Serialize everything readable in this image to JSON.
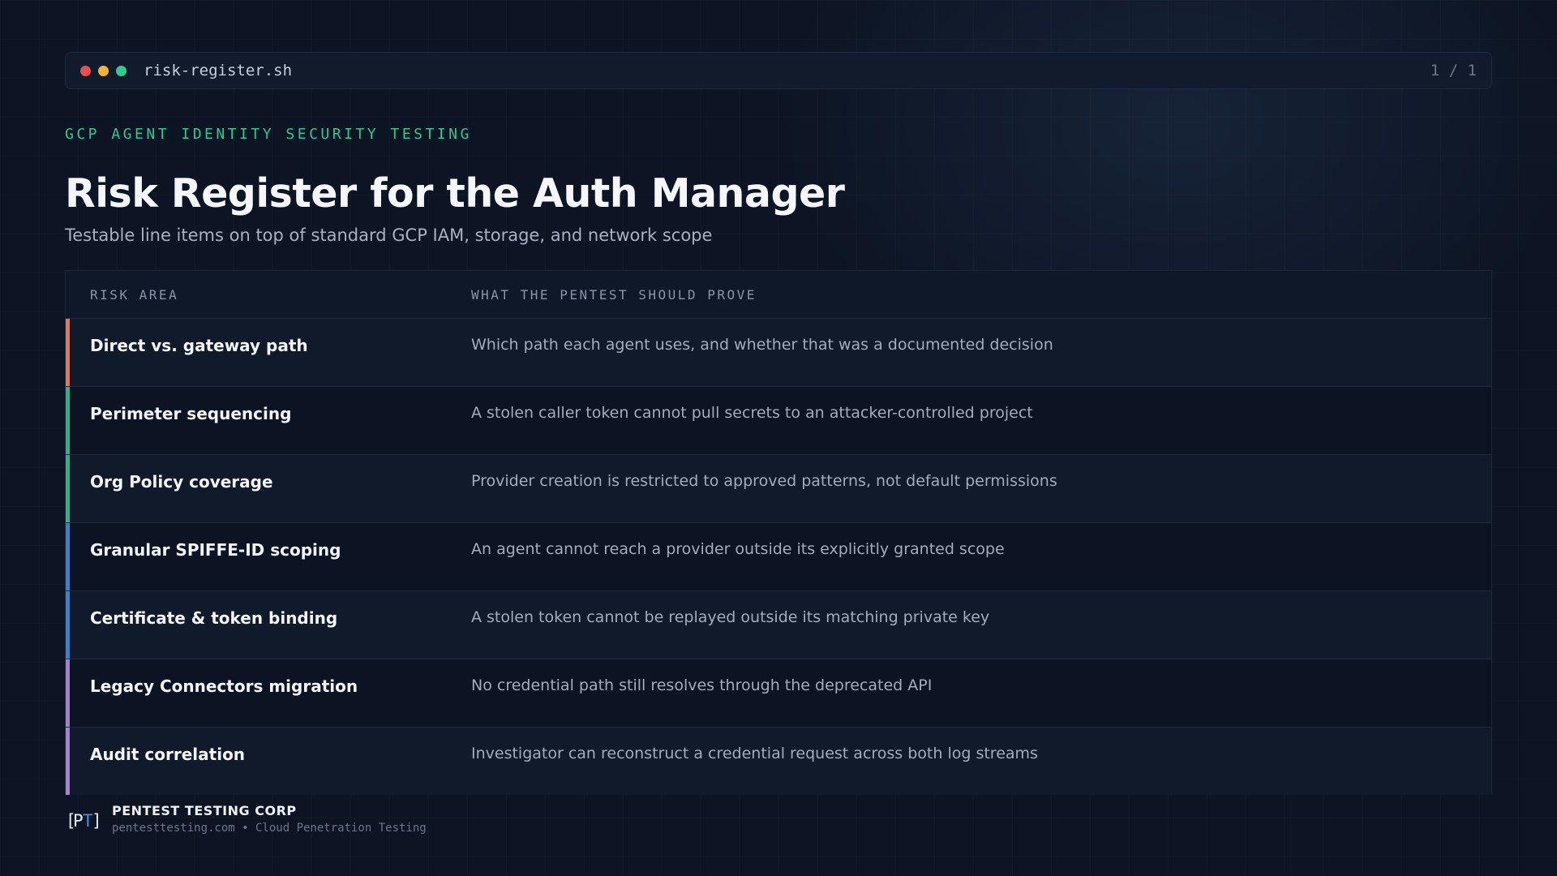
{
  "terminal": {
    "title": "risk-register.sh",
    "page_indicator": "1 / 1",
    "dot_colors": [
      "#ef4d4d",
      "#f2b233",
      "#2bcf8c"
    ]
  },
  "header": {
    "eyebrow": "GCP AGENT IDENTITY SECURITY TESTING",
    "title": "Risk Register for the Auth Manager",
    "subtitle": "Testable line items on top of standard GCP IAM, storage, and network scope"
  },
  "table": {
    "columns": [
      "RISK AREA",
      "WHAT THE PENTEST SHOULD PROVE"
    ],
    "rows": [
      {
        "area": "Direct vs. gateway path",
        "prove": "Which path each agent uses, and whether that was a documented decision",
        "accent": "#e8774a"
      },
      {
        "area": "Perimeter sequencing",
        "prove": "A stolen caller token cannot pull secrets to an attacker-controlled project",
        "accent": "#22b884"
      },
      {
        "area": "Org Policy coverage",
        "prove": "Provider creation is restricted to approved patterns, not default permissions",
        "accent": "#22b884"
      },
      {
        "area": "Granular SPIFFE-ID scoping",
        "prove": "An agent cannot reach a provider outside its explicitly granted scope",
        "accent": "#2f86d6"
      },
      {
        "area": "Certificate & token binding",
        "prove": "A stolen token cannot be replayed outside its matching private key",
        "accent": "#2f86d6"
      },
      {
        "area": "Legacy Connectors migration",
        "prove": "No credential path still resolves through the deprecated API",
        "accent": "#a97fd6"
      },
      {
        "area": "Audit correlation",
        "prove": "Investigator can reconstruct a credential request across both log streams",
        "accent": "#a97fd6"
      }
    ]
  },
  "footer": {
    "logo_text": "[PT]",
    "brand_name": "PENTEST TESTING CORP",
    "tagline": "pentesttesting.com • Cloud Penetration Testing"
  }
}
